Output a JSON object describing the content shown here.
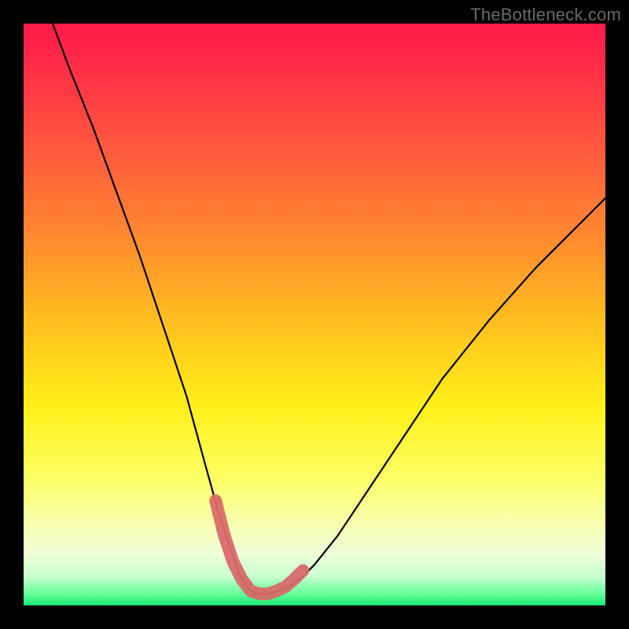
{
  "watermark": "TheBottleneck.com",
  "chart_data": {
    "type": "line",
    "title": "",
    "xlabel": "",
    "ylabel": "",
    "xlim": [
      0,
      100
    ],
    "ylim": [
      0,
      100
    ],
    "series": [
      {
        "name": "bottleneck-curve",
        "x": [
          5,
          8,
          12,
          16,
          20,
          24,
          28,
          31,
          33.5,
          35.5,
          37,
          38.5,
          40,
          42,
          44,
          46,
          48,
          50,
          54,
          58,
          64,
          72,
          80,
          88,
          96,
          100
        ],
        "y": [
          100,
          92,
          82,
          71,
          60,
          48,
          36,
          25,
          16,
          10,
          5.5,
          3,
          2,
          2,
          2.5,
          3.5,
          5,
          7,
          12,
          18,
          27,
          39,
          49,
          58,
          66,
          70
        ]
      },
      {
        "name": "highlight-segment",
        "x": [
          33,
          34.5,
          36,
          37.5,
          39,
          40.5,
          42,
          43.5,
          45,
          46.5,
          48
        ],
        "y": [
          18,
          12,
          7.5,
          4.5,
          2.5,
          2,
          2,
          2.5,
          3.2,
          4.5,
          6
        ]
      }
    ],
    "gradient_stops": [
      {
        "pos": 0,
        "color": "#ff1a4b"
      },
      {
        "pos": 22,
        "color": "#ff5a3e"
      },
      {
        "pos": 52,
        "color": "#ffc21e"
      },
      {
        "pos": 78,
        "color": "#fbff63"
      },
      {
        "pos": 95,
        "color": "#c8ffcf"
      },
      {
        "pos": 100,
        "color": "#16e873"
      }
    ]
  }
}
